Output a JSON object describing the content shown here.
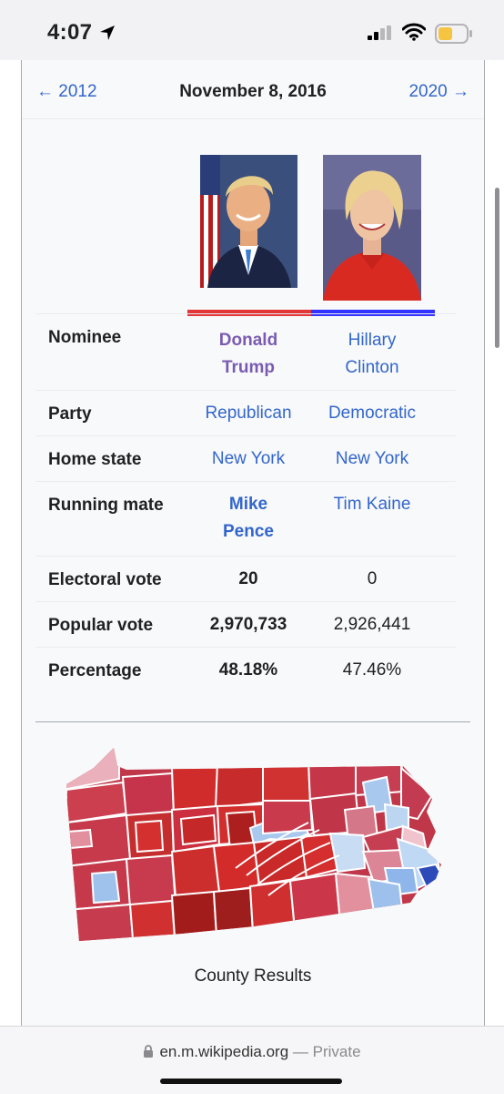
{
  "status_bar": {
    "time": "4:07"
  },
  "nav": {
    "prev": "← 2012",
    "date": "November 8, 2016",
    "next": "2020 →"
  },
  "candidates": [
    {
      "name_line1": "Donald",
      "name_line2": "Trump",
      "party": "Republican",
      "home_state": "New York",
      "mate_line1": "Mike",
      "mate_line2": "Pence",
      "electoral_vote": "20",
      "popular_vote": "2,970,733",
      "percentage": "48.18%",
      "color": "#e23737"
    },
    {
      "name_line1": "Hillary",
      "name_line2": "Clinton",
      "party": "Democratic",
      "home_state": "New York",
      "mate": "Tim Kaine",
      "electoral_vote": "0",
      "popular_vote": "2,926,441",
      "percentage": "47.46%",
      "color": "#3333ff"
    }
  ],
  "labels": {
    "nominee": "Nominee",
    "party": "Party",
    "home_state": "Home state",
    "running_mate": "Running mate",
    "electoral_vote": "Electoral vote",
    "popular_vote": "Popular vote",
    "percentage": "Percentage"
  },
  "map": {
    "caption": "County Results"
  },
  "browser": {
    "url": "en.m.wikipedia.org",
    "separator": " — ",
    "mode": "Private"
  }
}
